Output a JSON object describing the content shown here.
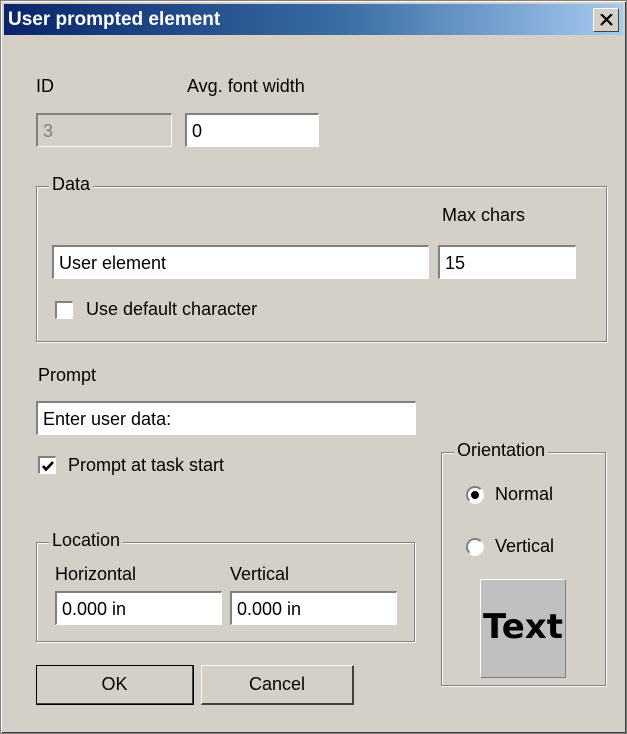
{
  "window": {
    "title": "User prompted element"
  },
  "fields": {
    "id_label": "ID",
    "id_value": "3",
    "font_width_label": "Avg. font width",
    "font_width_value": "0"
  },
  "data_group": {
    "legend": "Data",
    "max_chars_label": "Max chars",
    "text_value": "User element",
    "max_chars_value": "15",
    "use_default_label": "Use default character",
    "use_default_checked": false
  },
  "prompt": {
    "label": "Prompt",
    "value": "Enter user data:",
    "at_start_label": "Prompt at task start",
    "at_start_checked": true
  },
  "location": {
    "legend": "Location",
    "horizontal_label": "Horizontal",
    "vertical_label": "Vertical",
    "horizontal_value": "0.000 in",
    "vertical_value": "0.000 in"
  },
  "orientation": {
    "legend": "Orientation",
    "options": [
      {
        "label": "Normal",
        "selected": true
      },
      {
        "label": "Vertical",
        "selected": false
      }
    ],
    "preview_text": "Text"
  },
  "buttons": {
    "ok": "OK",
    "cancel": "Cancel"
  }
}
